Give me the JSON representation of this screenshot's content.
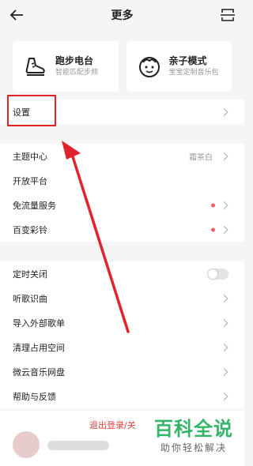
{
  "header": {
    "title": "更多",
    "back_icon": "arrow-left-icon",
    "scan_icon": "scan-icon"
  },
  "cards": [
    {
      "title": "跑步电台",
      "subtitle": "智能匹配步频",
      "icon": "running-shoe-icon"
    },
    {
      "title": "亲子模式",
      "subtitle": "宝宝定制音乐包",
      "icon": "child-face-icon"
    }
  ],
  "settings_row": {
    "label": "设置"
  },
  "group1": [
    {
      "label": "主题中心",
      "value": "霜茶白"
    },
    {
      "label": "开放平台"
    },
    {
      "label": "免流量服务",
      "dot": true
    },
    {
      "label": "百变彩铃",
      "dot": true
    }
  ],
  "group2": [
    {
      "label": "定时关闭",
      "toggle": false
    },
    {
      "label": "听歌识曲"
    },
    {
      "label": "导入外部歌单"
    },
    {
      "label": "清理占用空间"
    },
    {
      "label": "微云音乐网盘"
    },
    {
      "label": "帮助与反馈"
    }
  ],
  "bottom": {
    "logout": "退出登录/关"
  },
  "watermark": {
    "title": "百科全说",
    "subtitle": "助你轻松解决"
  },
  "colors": {
    "accent_red": "#e0242c",
    "dot": "#f25a6a",
    "watermark_green": "#35b56a"
  }
}
